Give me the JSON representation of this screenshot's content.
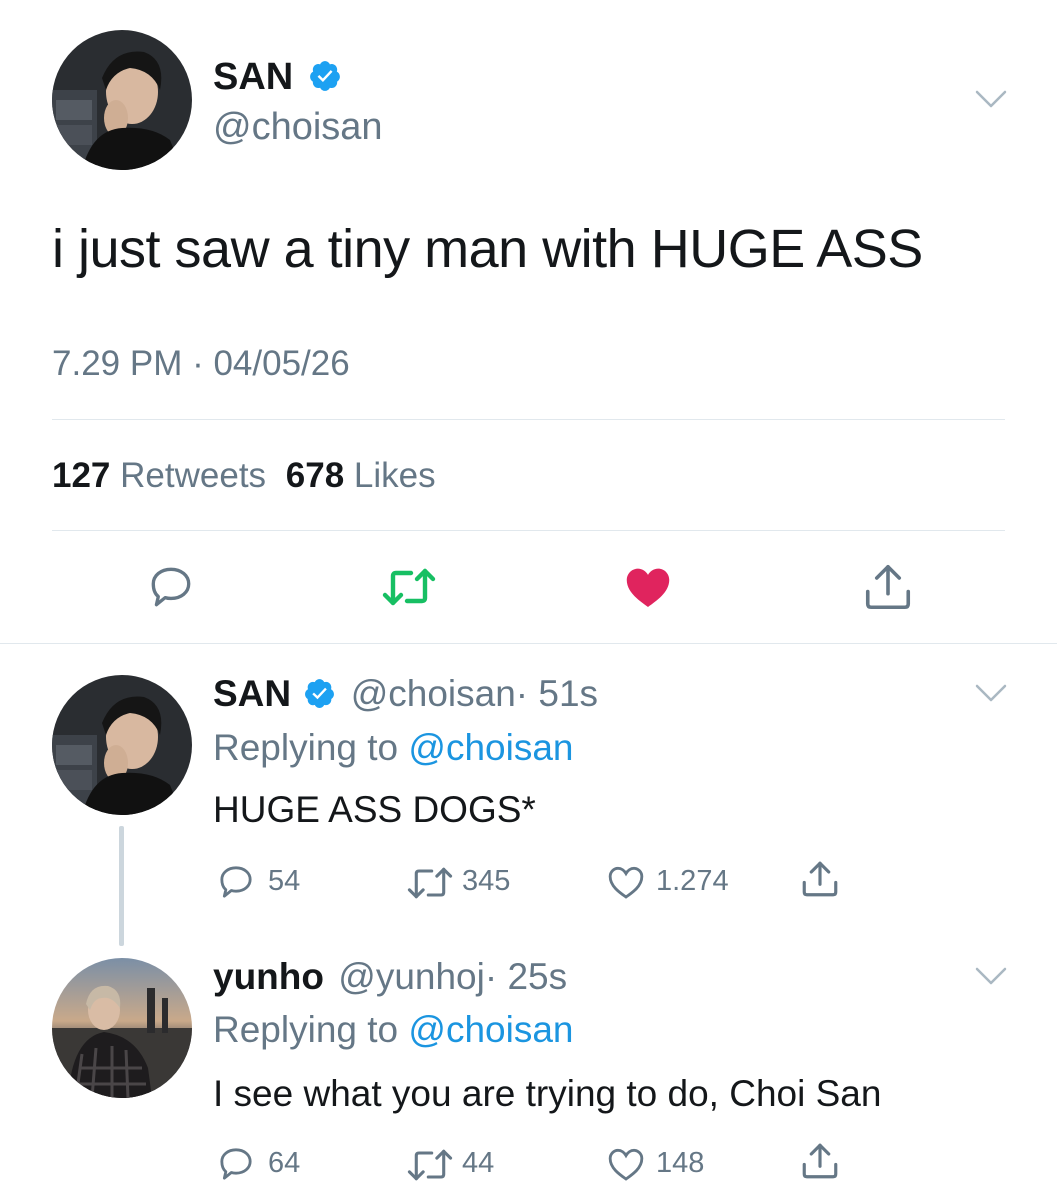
{
  "main_tweet": {
    "display_name": "SAN",
    "handle": "@choisan",
    "text": "i just saw a tiny man with HUGE ASS",
    "timestamp": "7.29 PM · 04/05/26",
    "retweets_count": "127",
    "retweets_label": "Retweets",
    "likes_count": "678",
    "likes_label": "Likes",
    "liked": true
  },
  "replies": [
    {
      "display_name": "SAN",
      "handle": "@choisan",
      "time": "· 51s",
      "replying_prefix": "Replying to",
      "replying_to": "@choisan",
      "text": "HUGE ASS DOGS*",
      "reply_count": "54",
      "retweet_count": "345",
      "like_count": "1.274",
      "verified": true
    },
    {
      "display_name": "yunho",
      "handle": "@yunhoj",
      "time": "· 25s",
      "replying_prefix": "Replying to",
      "replying_to": "@choisan",
      "text": "I see what you are trying to do, Choi San",
      "reply_count": "64",
      "retweet_count": "44",
      "like_count": "148",
      "verified": false
    }
  ],
  "colors": {
    "text": "#14171a",
    "secondary": "#657786",
    "link": "#1b95e0",
    "verified": "#1da1f2",
    "retweet": "#17bf63",
    "like": "#e0245e",
    "divider": "#e1e8ed"
  }
}
